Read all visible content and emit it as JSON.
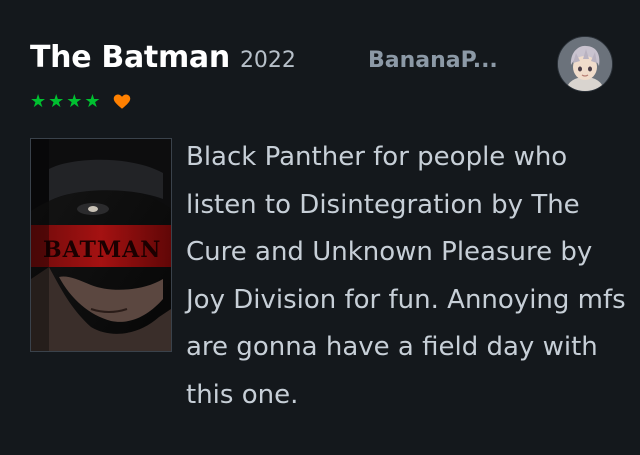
{
  "film": {
    "title": "The Batman",
    "year": "2022"
  },
  "user": {
    "name": "BananaP..."
  },
  "rating": {
    "stars": 4,
    "max_stars": 5,
    "liked": true,
    "star_color": "#00c030",
    "like_color": "#ff8000"
  },
  "poster": {
    "wordmark": "BATMAN"
  },
  "review": {
    "text": "Black Panther for people who listen to Disintegration by The Cure and Unknown Pleasure by Joy Division for fun. Annoying mfs are gonna have a field day with this one."
  },
  "icons": {
    "star": "star-icon",
    "like": "heart-icon"
  }
}
